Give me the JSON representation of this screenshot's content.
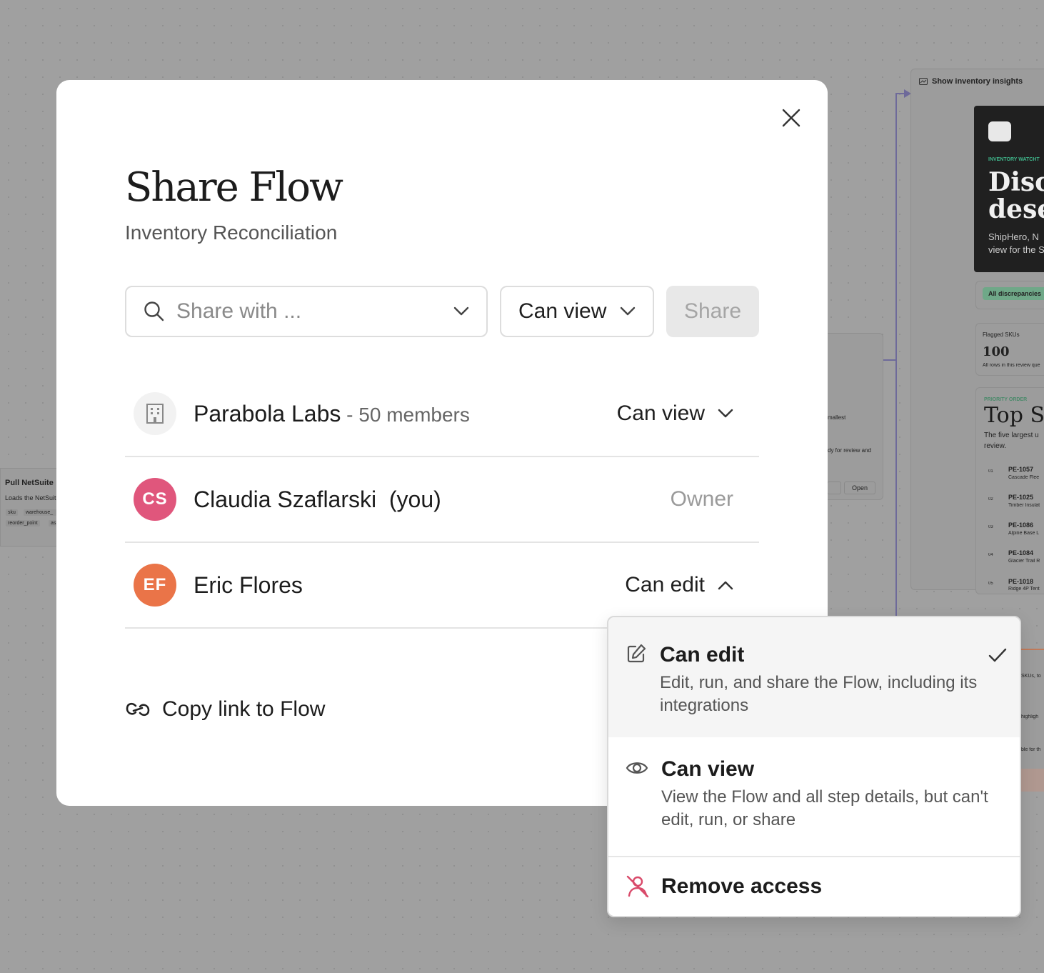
{
  "background": {
    "insights_card": {
      "title": "Show inventory insights"
    },
    "hero_card": {
      "eyebrow": "INVENTORY WATCHT",
      "heading_line1": "Disc",
      "heading_line2": "dese",
      "body_line1": "ShipHero, N",
      "body_line2": "view for the S"
    },
    "filter_chip": "All discrepancies",
    "flagged": {
      "label": "Flagged SKUs",
      "value": "100",
      "note": "All rows in this review que"
    },
    "priority": {
      "eyebrow": "PRIORITY ORDER",
      "heading": "Top SK",
      "desc_line1": "The five largest u",
      "desc_line2": "review.",
      "items": [
        {
          "rank": "01",
          "sku": "PE-1057",
          "name": "Cascade Flee"
        },
        {
          "rank": "02",
          "sku": "PE-1025",
          "name": "Timber Insulat"
        },
        {
          "rank": "03",
          "sku": "PE-1086",
          "name": "Alpine Base L"
        },
        {
          "rank": "04",
          "sku": "PE-1084",
          "name": "Glacier Trail R"
        },
        {
          "rank": "05",
          "sku": "PE-1018",
          "name": "Ridge 4P Tent"
        }
      ]
    },
    "mid_card": {
      "text1": "mallest",
      "text2": "dy for review and",
      "open_label": "Open"
    },
    "left_node": {
      "title": "Pull NetSuite",
      "desc": "Loads the NetSuit",
      "chips": [
        "sku",
        "warehouse_",
        "reorder_point",
        "as"
      ]
    },
    "right_fragments": [
      "SKUs, to",
      "highligh",
      "ble for th"
    ]
  },
  "modal": {
    "title": "Share Flow",
    "subtitle": "Inventory Reconciliation",
    "search": {
      "placeholder": "Share with ..."
    },
    "permission_select": {
      "value": "Can view"
    },
    "share_button": "Share",
    "members": [
      {
        "name": "Parabola Labs",
        "separator": " - ",
        "meta": "50 members",
        "permission": "Can view",
        "icon": "building-icon"
      },
      {
        "initials": "CS",
        "name": "Claudia Szaflarski",
        "suffix": "(you)",
        "permission": "Owner",
        "avatar_color": "#e0567c"
      },
      {
        "initials": "EF",
        "name": "Eric Flores",
        "permission": "Can edit",
        "avatar_color": "#ea7448"
      }
    ],
    "copy_link": "Copy link to Flow"
  },
  "dropdown": {
    "options": [
      {
        "label": "Can edit",
        "description": "Edit, run, and share the Flow, including its integrations",
        "icon": "pencil-icon",
        "selected": true
      },
      {
        "label": "Can view",
        "description": "View the Flow and all step details, but can't edit, run, or share",
        "icon": "eye-icon",
        "selected": false
      }
    ],
    "remove_label": "Remove access",
    "remove_icon": "user-remove-icon",
    "remove_color": "#d94a6a"
  }
}
